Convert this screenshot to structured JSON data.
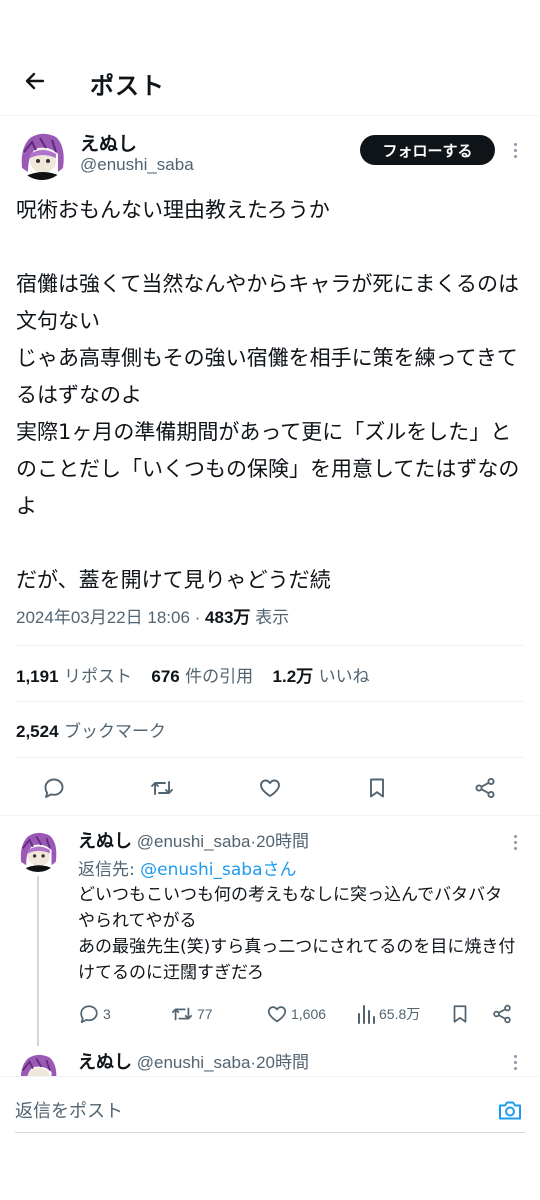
{
  "header": {
    "title": "ポスト"
  },
  "author": {
    "name": "えぬし",
    "handle": "@enushi_saba",
    "follow_label": "フォローする"
  },
  "tweet": {
    "text": "呪術おもんない理由教えたろうか\n\n宿儺は強くて当然なんやからキャラが死にまくるのは文句ない\nじゃあ高専側もその強い宿儺を相手に策を練ってきてるはずなのよ\n実際1ヶ月の準備期間があって更に「ズルをした」とのことだし「いくつもの保険」を用意してたはずなのよ\n\nだが、蓋を開けて見りゃどうだ続",
    "datetime": "2024年03月22日 18:06",
    "views": "483万",
    "views_label": "表示"
  },
  "stats": {
    "reposts": "1,191",
    "reposts_label": "リポスト",
    "quotes": "676",
    "quotes_label": "件の引用",
    "likes": "1.2万",
    "likes_label": "いいね",
    "bookmarks": "2,524",
    "bookmarks_label": "ブックマーク"
  },
  "actions": {
    "reply_icon": "reply-icon",
    "repost_icon": "repost-icon",
    "like_icon": "heart-icon",
    "bookmark_icon": "bookmark-icon",
    "share_icon": "share-icon"
  },
  "replies": [
    {
      "name": "えぬし",
      "handle": "@enushi_saba",
      "time": "20時間",
      "reply_to_label": "返信先:",
      "reply_to_handle": "@enushi_saba",
      "reply_to_suffix": "さん",
      "text": "どいつもこいつも何の考えもなしに突っ込んでバタバタやられてやがる\nあの最強先生(笑)すら真っ二つにされてるのを目に焼き付けてるのに迂闊すぎだろ",
      "reply_count": "3",
      "repost_count": "77",
      "like_count": "1,606",
      "view_count": "65.8万"
    },
    {
      "name": "えぬし",
      "handle": "@enushi_saba",
      "time": "20時間"
    }
  ],
  "composer": {
    "placeholder": "返信をポスト"
  },
  "colors": {
    "accent": "#1d9bf0",
    "text": "#0f1419",
    "muted": "#536471",
    "follow_bg": "#0f1419"
  }
}
